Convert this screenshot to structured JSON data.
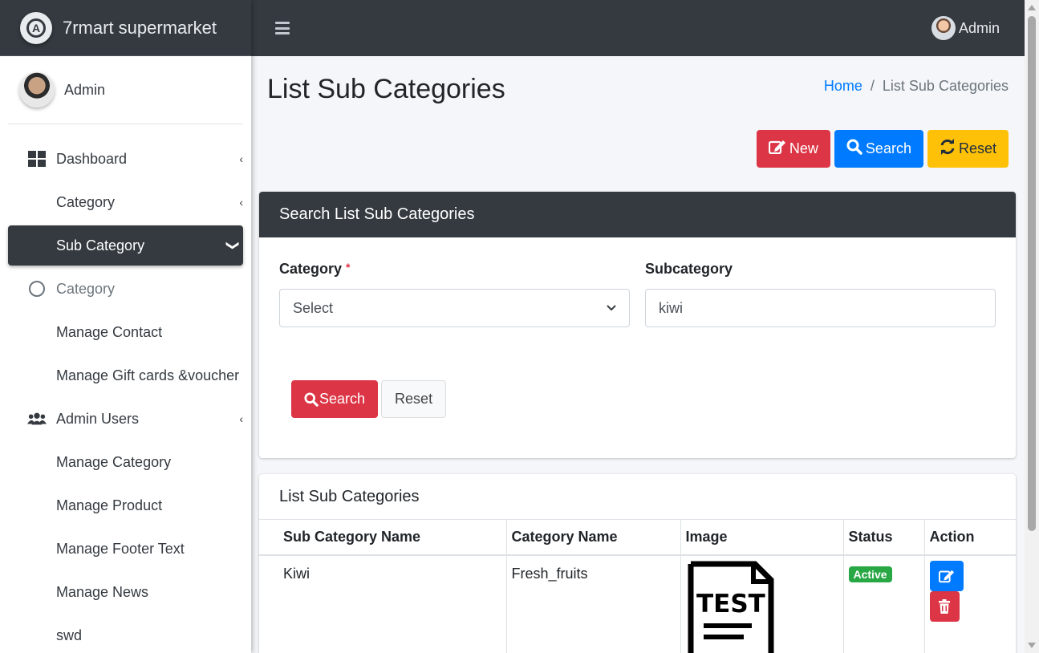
{
  "brand": {
    "name": "7rmart supermarket"
  },
  "sidebar": {
    "user_name": "Admin",
    "items": [
      {
        "label": "Dashboard",
        "icon": "dashboard-grid-icon",
        "caret": "‹"
      },
      {
        "label": "Category",
        "caret": "‹"
      },
      {
        "label": "Sub Category",
        "caret": "❯",
        "active": true
      },
      {
        "label": "Category",
        "icon": "circle-icon"
      },
      {
        "label": "Manage Contact"
      },
      {
        "label": "Manage Gift cards &voucher"
      },
      {
        "label": "Admin Users",
        "icon": "users-icon",
        "caret": "‹"
      },
      {
        "label": "Manage Category"
      },
      {
        "label": "Manage Product"
      },
      {
        "label": "Manage Footer Text"
      },
      {
        "label": "Manage News"
      },
      {
        "label": "swd"
      }
    ]
  },
  "topbar": {
    "user_name": "Admin",
    "menu_icon": "hamburger-icon"
  },
  "page": {
    "title": "List Sub Categories",
    "breadcrumb": {
      "home": "Home",
      "separator": "/",
      "current": "List Sub Categories"
    }
  },
  "toolbar": {
    "new_label": "New",
    "search_label": "Search",
    "reset_label": "Reset"
  },
  "search_card": {
    "header": "Search List Sub Categories",
    "category_label": "Category",
    "required_mark": "*",
    "category_value": "Select",
    "subcategory_label": "Subcategory",
    "subcategory_value": "kiwi",
    "search_button": "Search",
    "reset_button": "Reset"
  },
  "list_card": {
    "title": "List Sub Categories",
    "columns": [
      "Sub Category Name",
      "Category Name",
      "Image",
      "Status",
      "Action"
    ],
    "rows": [
      {
        "sub_category": "Kiwi",
        "category": "Fresh_fruits",
        "image_text": "TEST",
        "status": "Active"
      }
    ]
  },
  "colors": {
    "dark": "#343a40",
    "danger": "#dc3545",
    "primary": "#007bff",
    "warning": "#ffc107",
    "success": "#28a745"
  }
}
